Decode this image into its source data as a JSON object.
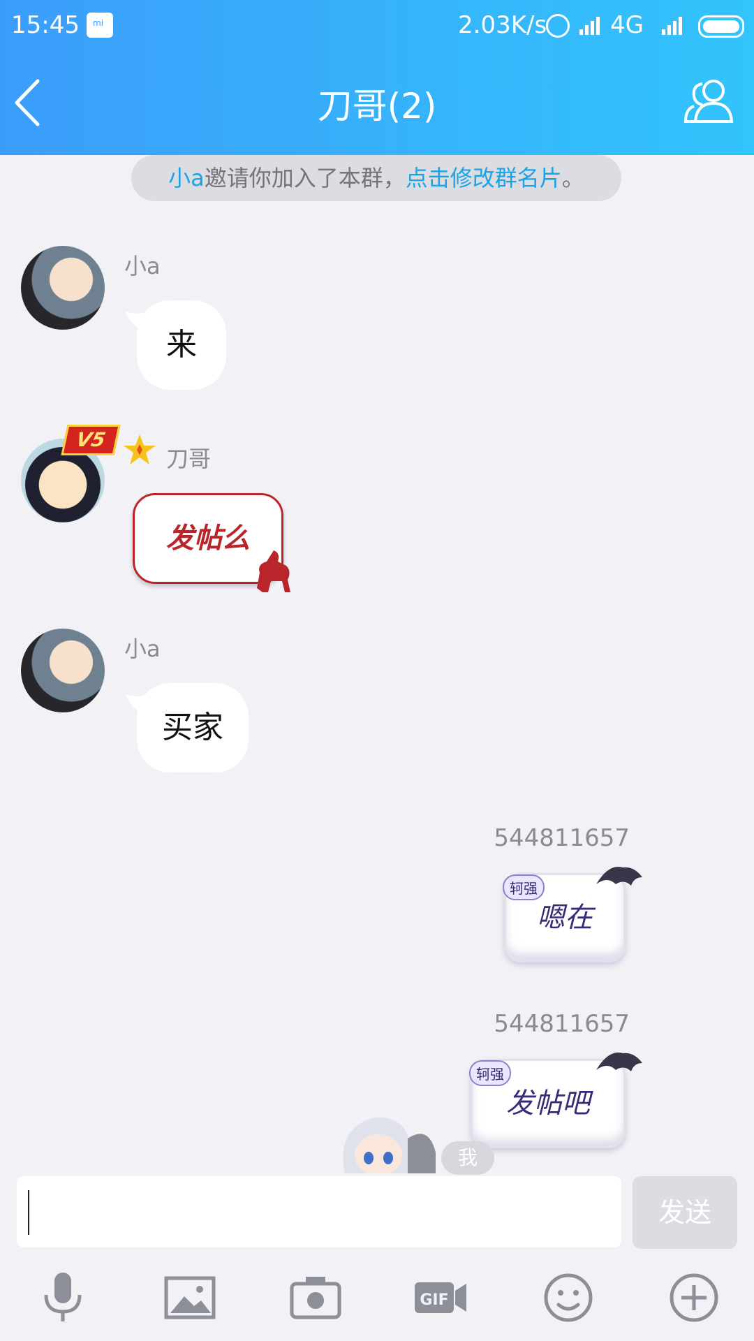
{
  "status_bar": {
    "time": "15:45",
    "network_speed": "2.03K/s",
    "network_type": "4G"
  },
  "header": {
    "title": "刀哥(2)"
  },
  "notice": {
    "inviter": "小a",
    "text_middle": "邀请你加入了本群，",
    "link": "点击修改群名片",
    "tail": "。"
  },
  "messages": [
    {
      "sender": "小a",
      "text": "来"
    },
    {
      "sender": "刀哥",
      "badge": "V5",
      "text": "发帖么"
    },
    {
      "sender": "小a",
      "text": "买家"
    },
    {
      "sender": "544811657",
      "tag": "轲强",
      "text": "嗯在"
    },
    {
      "sender": "544811657",
      "tag": "轲强",
      "text": "发帖吧"
    }
  ],
  "self_tag": "我",
  "composer": {
    "input_value": "",
    "send_label": "发送"
  },
  "toolbar": [
    "mic-icon",
    "image-icon",
    "camera-icon",
    "gif-icon",
    "emoji-icon",
    "plus-icon"
  ],
  "colors": {
    "header_start": "#3b9dfb",
    "header_end": "#32c4fc",
    "link_blue": "#19a4e6",
    "red_bubble": "#b8262b"
  }
}
